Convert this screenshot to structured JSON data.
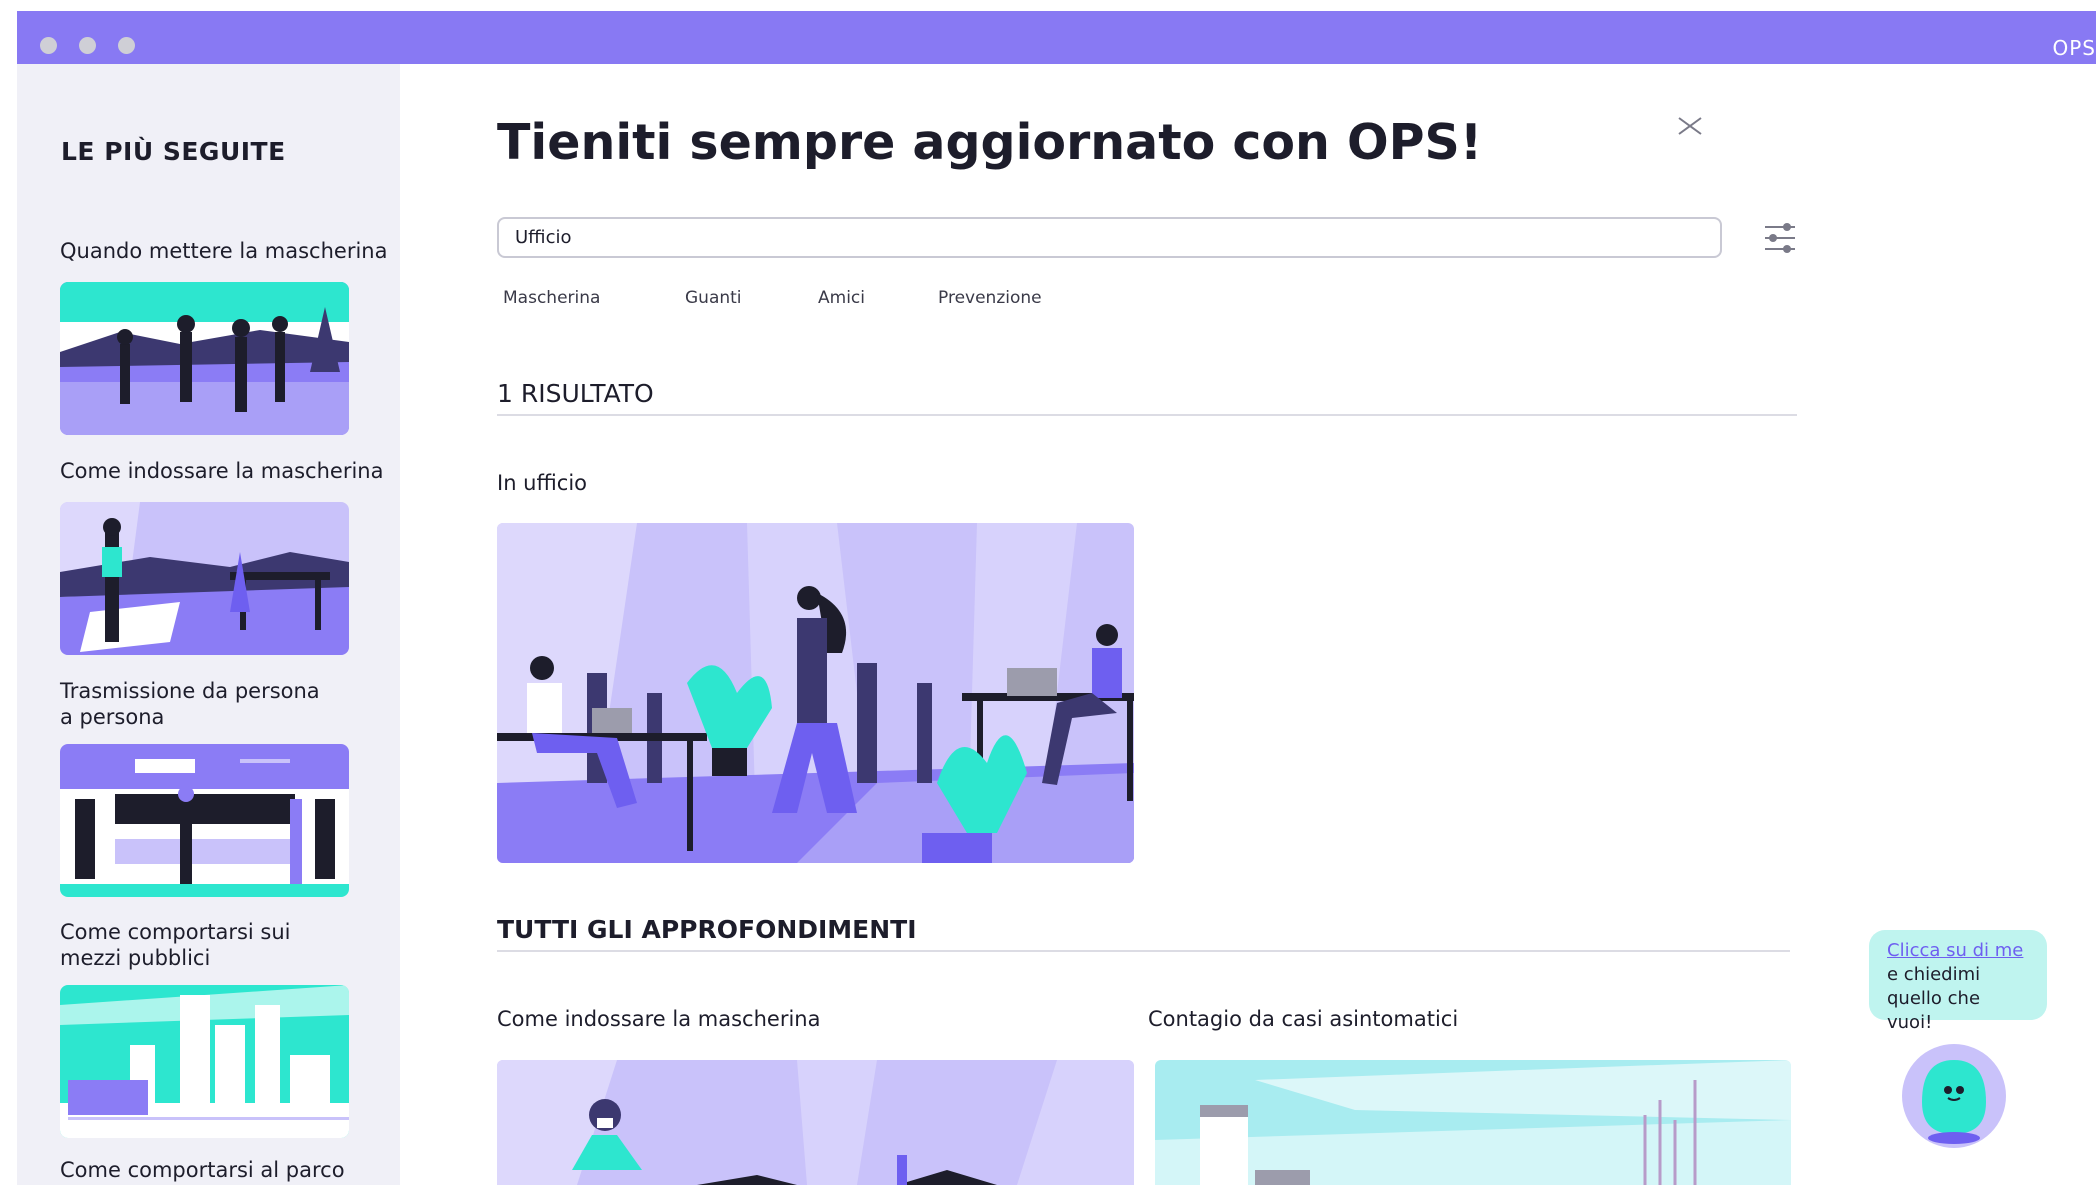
{
  "window": {
    "app_name": "OPS"
  },
  "sidebar": {
    "title": "LE PIÙ SEGUITE",
    "items": [
      {
        "label": "Quando mettere la mascherina"
      },
      {
        "label": "Come indossare  la mascherina"
      },
      {
        "label": "Trasmissione da persona a persona"
      },
      {
        "label": "Come comportarsi sui mezzi pubblici"
      },
      {
        "label": "Come comportarsi al parco"
      }
    ]
  },
  "main": {
    "title": "Tieniti sempre aggiornato con OPS!",
    "search": {
      "value": "Ufficio"
    },
    "chips": [
      "Mascherina",
      "Guanti",
      "Amici",
      "Prevenzione"
    ],
    "results_heading": "1 RISULTATO",
    "result": {
      "label": "In ufficio"
    },
    "all_heading": "TUTTI GLI APPROFONDIMENTI",
    "cards": [
      {
        "label": "Come indossare la mascherina"
      },
      {
        "label": "Contagio da casi asintomatici"
      }
    ]
  },
  "chatbot": {
    "link": "Clicca su di me",
    "line1": "e chiedimi",
    "line2": "quello che vuoi!"
  },
  "colors": {
    "accent": "#8879f3",
    "teal": "#2de6cf",
    "sidebar_bg": "#f0f0f7",
    "bubble_bg": "#bff4ef"
  }
}
